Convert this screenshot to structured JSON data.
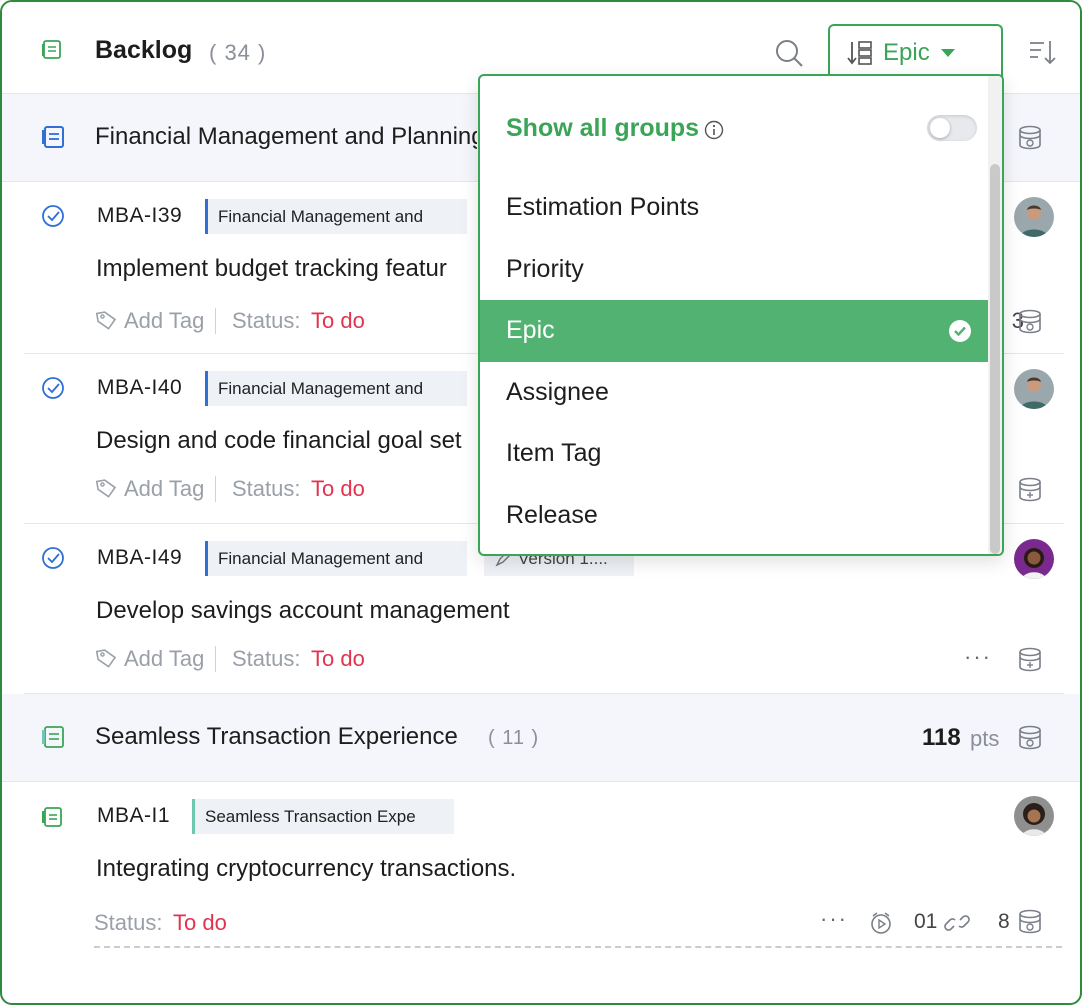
{
  "header": {
    "title": "Backlog",
    "count": "( 34 )",
    "group_by_label": "Epic"
  },
  "groups": [
    {
      "title": "Financial Management and Planning",
      "count": "",
      "pts_value": "",
      "pts_label": ""
    },
    {
      "title": "Seamless Transaction Experience",
      "count": "( 11 )",
      "pts_value": "118",
      "pts_label": "pts"
    }
  ],
  "items": [
    {
      "id": "MBA-I39",
      "epic": "Financial Management and",
      "title": "Implement budget tracking featur",
      "add_tag": "Add Tag",
      "status_label": "Status:",
      "status_value": "To do",
      "points": "3"
    },
    {
      "id": "MBA-I40",
      "epic": "Financial Management and",
      "title": "Design and code financial goal set",
      "add_tag": "Add Tag",
      "status_label": "Status:",
      "status_value": "To do"
    },
    {
      "id": "MBA-I49",
      "epic": "Financial Management and",
      "release": "Version 1....",
      "title": "Develop savings account management",
      "add_tag": "Add Tag",
      "status_label": "Status:",
      "status_value": "To do",
      "more": "···"
    },
    {
      "id": "MBA-I1",
      "epic": "Seamless Transaction Expe",
      "title": "Integrating cryptocurrency transactions.",
      "status_label": "Status:",
      "status_value": "To do",
      "more": "···",
      "links": "01",
      "points": "8"
    }
  ],
  "dropdown": {
    "show_all_groups": "Show all groups",
    "toggle_on": false,
    "options": [
      "Estimation Points",
      "Priority",
      "Epic",
      "Assignee",
      "Item Tag",
      "Release"
    ],
    "selected": "Epic"
  },
  "colors": {
    "accent_green": "#3aa557",
    "selected_bg": "#52b272",
    "status_red": "#e0344f",
    "epic_bar_blue": "#2f6fd6",
    "epic_bar_teal": "#6fc7b0"
  }
}
